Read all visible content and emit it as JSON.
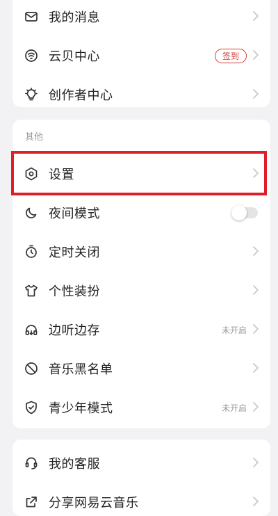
{
  "top_card": {
    "items": [
      {
        "label": "我的消息",
        "icon": "mail-icon"
      },
      {
        "label": "云贝中心",
        "icon": "coin-icon",
        "badge": "签到"
      },
      {
        "label": "创作者中心",
        "icon": "lightbulb-icon"
      }
    ]
  },
  "other_card": {
    "section_title": "其他",
    "items": [
      {
        "label": "设置",
        "icon": "settings-hexagon-icon"
      },
      {
        "label": "夜间模式",
        "icon": "moon-icon",
        "toggle": false
      },
      {
        "label": "定时关闭",
        "icon": "timer-icon"
      },
      {
        "label": "个性装扮",
        "icon": "tshirt-icon"
      },
      {
        "label": "边听边存",
        "icon": "headphones-icon",
        "status": "未开启"
      },
      {
        "label": "音乐黑名单",
        "icon": "block-icon"
      },
      {
        "label": "青少年模式",
        "icon": "shield-check-icon",
        "status": "未开启"
      }
    ]
  },
  "bottom_card": {
    "items": [
      {
        "label": "我的客服",
        "icon": "headset-icon"
      },
      {
        "label": "分享网易云音乐",
        "icon": "share-icon"
      }
    ]
  },
  "colors": {
    "accent": "#d43c33",
    "highlight_box": "#e01e25",
    "background": "#f2f2f4"
  }
}
